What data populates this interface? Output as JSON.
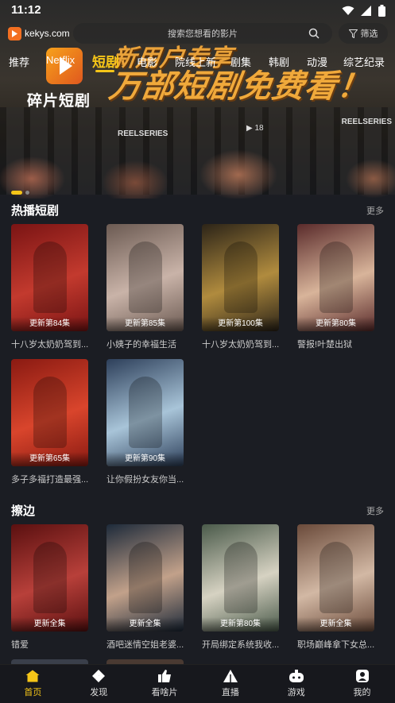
{
  "status": {
    "time": "11:12"
  },
  "header": {
    "site": "kekys.com",
    "search_placeholder": "搜索您想看的影片",
    "filter_label": "筛选"
  },
  "tabs": [
    {
      "label": "推荐",
      "active": false
    },
    {
      "label": "Netflix",
      "active": false
    },
    {
      "label": "短剧",
      "active": true
    },
    {
      "label": "电影",
      "active": false
    },
    {
      "label": "院线上新",
      "active": false
    },
    {
      "label": "剧集",
      "active": false
    },
    {
      "label": "韩剧",
      "active": false
    },
    {
      "label": "动漫",
      "active": false
    },
    {
      "label": "综艺纪录",
      "active": false
    }
  ],
  "banner": {
    "logo_text": "碎片短剧",
    "headline": "万部短剧免费看！",
    "badge_top": "新用户专享",
    "sub1": "REELSERIES",
    "sub2": "REELSERIES",
    "count": "18"
  },
  "sections": [
    {
      "title": "热播短剧",
      "more": "更多",
      "cards": [
        {
          "tag": "更新第84集",
          "title": "十八岁太奶奶驾到...",
          "c1": "#7a1414",
          "c2": "#c33a2e"
        },
        {
          "tag": "更新第85集",
          "title": "小姨子的幸福生活",
          "c1": "#6b5a52",
          "c2": "#c9b3a8"
        },
        {
          "tag": "更新第100集",
          "title": "十八岁太奶奶驾到...",
          "c1": "#2c2418",
          "c2": "#b08b3e"
        },
        {
          "tag": "更新第80集",
          "title": "警报!叶楚出狱",
          "c1": "#5a2b2b",
          "c2": "#d8b49a"
        },
        {
          "tag": "更新第65集",
          "title": "多子多福打造最强...",
          "c1": "#8a1a12",
          "c2": "#d9452c"
        },
        {
          "tag": "更新第90集",
          "title": "让你假扮女友你当...",
          "c1": "#2d3f5a",
          "c2": "#a8c4d8"
        }
      ]
    },
    {
      "title": "擦边",
      "more": "更多",
      "cards": [
        {
          "tag": "更新全集",
          "title": "错爱",
          "c1": "#5a1010",
          "c2": "#b8403a"
        },
        {
          "tag": "更新全集",
          "title": "酒吧迷情空姐老婆...",
          "c1": "#1d2a3a",
          "c2": "#c2a18a"
        },
        {
          "tag": "更新第80集",
          "title": "开局绑定系统我收...",
          "c1": "#4a5a4a",
          "c2": "#d6d2c2"
        },
        {
          "tag": "更新全集",
          "title": "职场巅峰拿下女总...",
          "c1": "#6a4a3a",
          "c2": "#d2b8a4"
        }
      ]
    }
  ],
  "nav": [
    {
      "label": "首页",
      "icon": "home-icon",
      "active": true
    },
    {
      "label": "发现",
      "icon": "discover-icon",
      "active": false
    },
    {
      "label": "看啥片",
      "icon": "thumbs-up-icon",
      "active": false
    },
    {
      "label": "直播",
      "icon": "live-icon",
      "active": false
    },
    {
      "label": "游戏",
      "icon": "gamepad-icon",
      "active": false
    },
    {
      "label": "我的",
      "icon": "profile-icon",
      "active": false
    }
  ],
  "colors": {
    "accent": "#f5c518",
    "background": "#1b1d23"
  }
}
